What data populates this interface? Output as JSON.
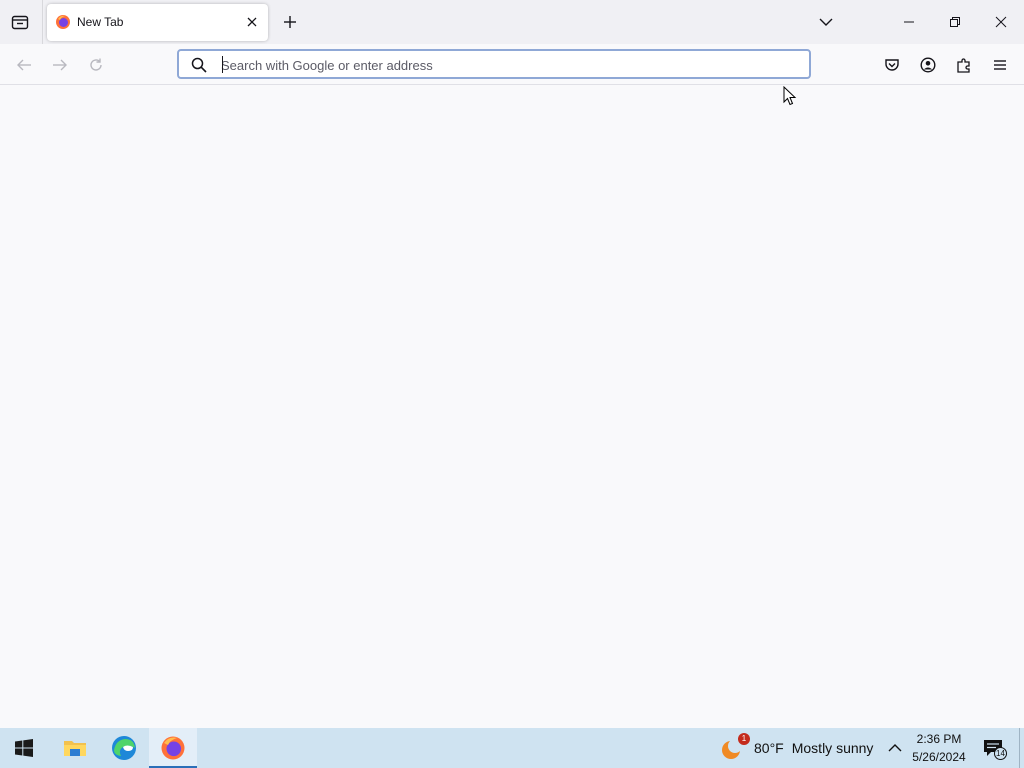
{
  "browser": {
    "tab": {
      "title": "New Tab",
      "favicon": "firefox-icon"
    },
    "urlbar": {
      "placeholder": "Search with Google or enter address",
      "value": ""
    },
    "icons": {
      "tab_list": "firefox-view-icon",
      "new_tab": "plus-icon",
      "list_all_tabs": "chevron-down-icon",
      "back": "arrow-left-icon",
      "forward": "arrow-right-icon",
      "reload": "reload-icon",
      "pocket": "pocket-icon",
      "account": "account-icon",
      "extensions": "puzzle-icon",
      "menu": "hamburger-icon"
    },
    "window_controls": [
      "minimize",
      "maximize",
      "close"
    ]
  },
  "taskbar": {
    "apps": [
      "windows-start",
      "file-explorer",
      "microsoft-edge",
      "firefox"
    ],
    "weather": {
      "temperature": "80°F",
      "condition": "Mostly sunny",
      "badge": "1"
    },
    "clock": {
      "time": "2:36 PM",
      "date": "5/26/2024"
    },
    "notifications": {
      "count": "14"
    }
  },
  "colors": {
    "tabstrip_bg": "#f0f0f4",
    "content_bg": "#f9f9fb",
    "taskbar_bg": "#cfe3f1",
    "urlbar_focus": "#8fa8d6"
  }
}
